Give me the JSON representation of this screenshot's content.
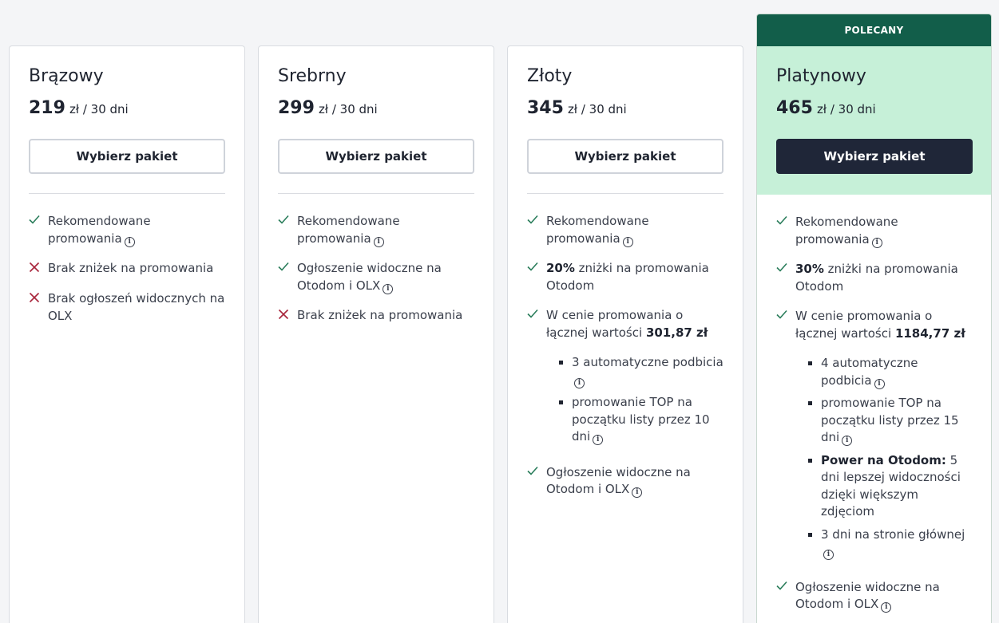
{
  "badge": "POLECANY",
  "colors": {
    "check": "#2a7d5b",
    "cross": "#a8253b",
    "highlight": "#c6f0d8",
    "badge": "#125e4a",
    "dark_button": "#1f2638"
  },
  "plans": [
    {
      "name": "Brązowy",
      "price": "219",
      "period": "zł / 30 dni",
      "button": "Wybierz pakiet",
      "features": [
        {
          "type": "check",
          "text": "Rekomendowane promowania"
        },
        {
          "type": "cross",
          "text": "Brak zniżek na promowania"
        },
        {
          "type": "cross",
          "text": "Brak ogłoszeń widocznych na OLX"
        }
      ]
    },
    {
      "name": "Srebrny",
      "price": "299",
      "period": "zł / 30 dni",
      "button": "Wybierz pakiet",
      "features": [
        {
          "type": "check",
          "text": "Rekomendowane promowania"
        },
        {
          "type": "check",
          "text": "Ogłoszenie widoczne na Otodom i OLX"
        },
        {
          "type": "cross",
          "text": "Brak zniżek na promowania"
        }
      ]
    },
    {
      "name": "Złoty",
      "price": "345",
      "period": "zł / 30 dni",
      "button": "Wybierz pakiet",
      "features": [
        {
          "type": "check",
          "text": "Rekomendowane promowania"
        },
        {
          "type": "check",
          "bold": "20%",
          "text": " zniżki na promowania Otodom"
        },
        {
          "type": "check",
          "text": "W cenie promowania o łącznej wartości ",
          "bold_end": "301,87 zł",
          "sub": [
            {
              "text": "3 automatyczne podbicia"
            },
            {
              "text": "promowanie TOP na początku listy przez 10 dni"
            }
          ]
        },
        {
          "type": "check",
          "text": "Ogłoszenie widoczne na Otodom i OLX"
        }
      ]
    },
    {
      "name": "Platynowy",
      "price": "465",
      "period": "zł / 30 dni",
      "button": "Wybierz pakiet",
      "features": [
        {
          "type": "check",
          "text": "Rekomendowane promowania"
        },
        {
          "type": "check",
          "bold": "30%",
          "text": " zniżki na promowania Otodom"
        },
        {
          "type": "check",
          "text": "W cenie promowania o łącznej wartości ",
          "bold_end": "1184,77 zł",
          "sub": [
            {
              "text": "4 automatyczne podbicia"
            },
            {
              "text": "promowanie TOP na początku listy przez 15 dni"
            },
            {
              "bold": "Power na Otodom:",
              "text": " 5 dni lepszej widoczności dzięki większym zdjęciom"
            },
            {
              "text": "3 dni na stronie głównej"
            }
          ]
        },
        {
          "type": "check",
          "text": "Ogłoszenie widoczne na Otodom i OLX"
        }
      ]
    }
  ]
}
